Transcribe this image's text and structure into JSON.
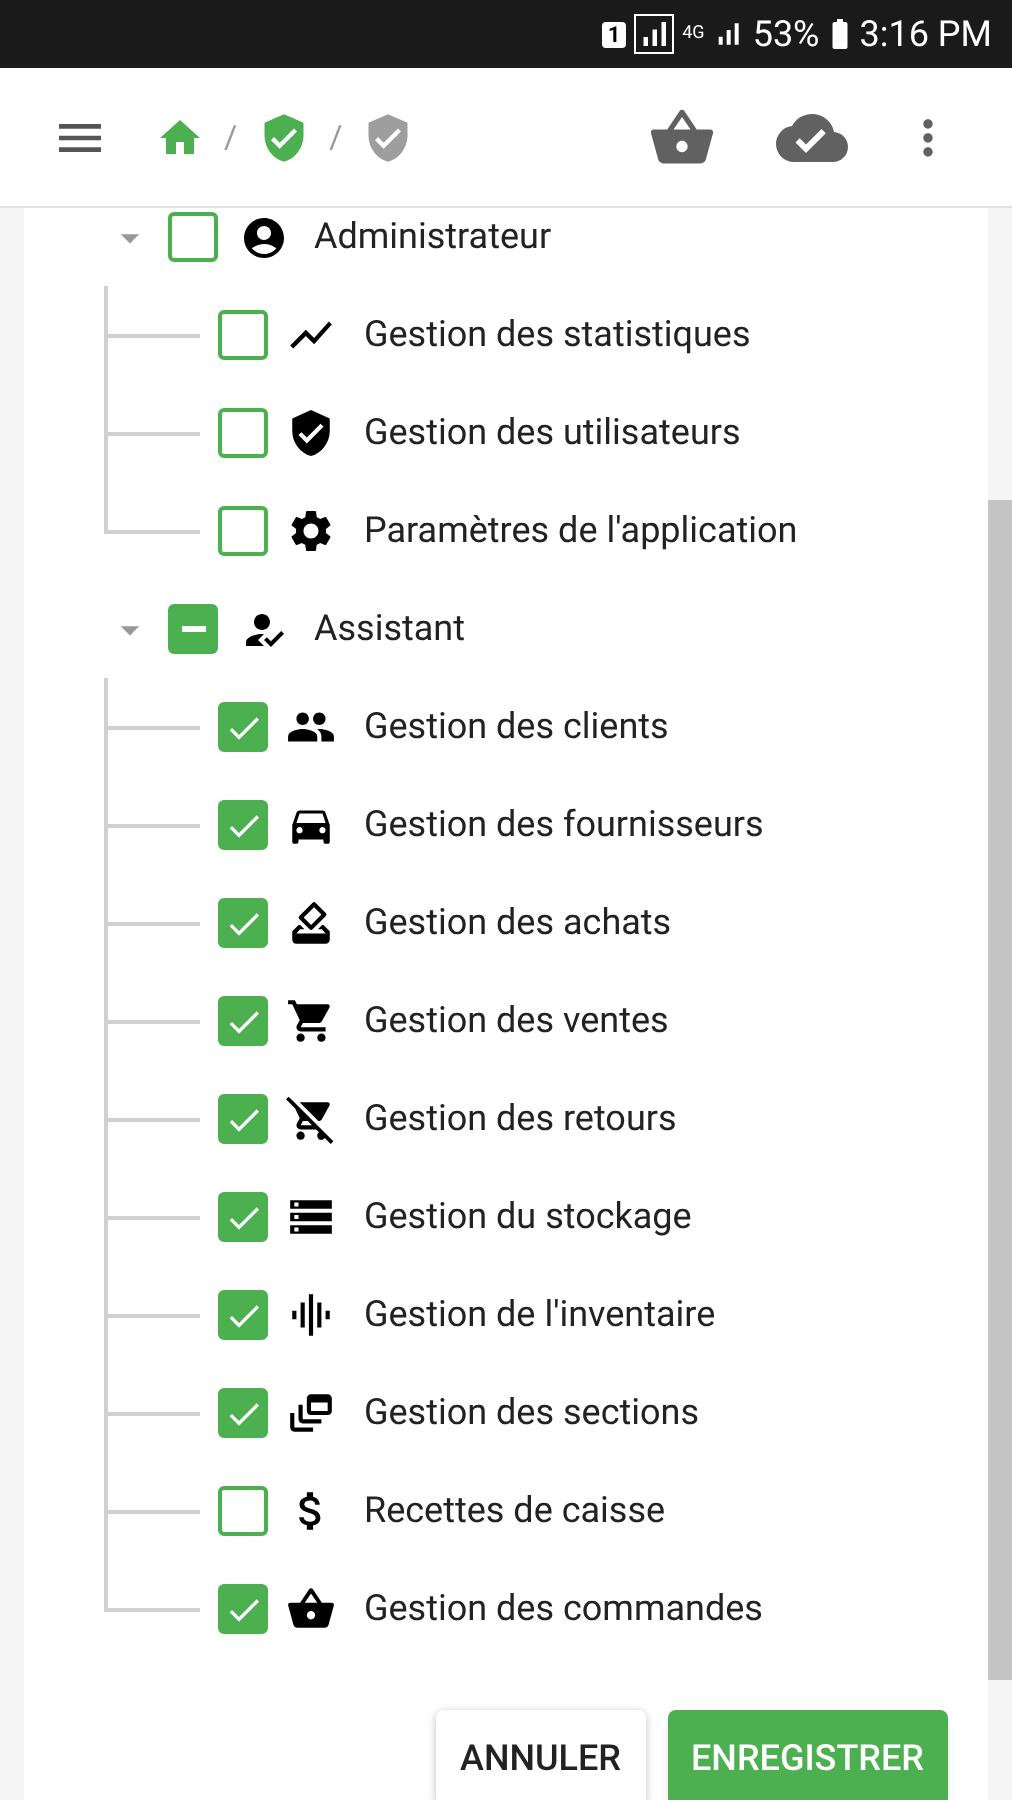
{
  "status_bar": {
    "sim": "1",
    "network": "4G",
    "battery": "53%",
    "time": "3:16 PM"
  },
  "breadcrumb": {
    "separators": [
      "/",
      "/"
    ]
  },
  "tree": [
    {
      "label": "Administrateur",
      "expanded": true,
      "indeterminate": false,
      "children": [
        {
          "label": "Gestion des statistiques",
          "checked": false
        },
        {
          "label": "Gestion des utilisateurs",
          "checked": false
        },
        {
          "label": "Paramètres de l'application",
          "checked": false
        }
      ]
    },
    {
      "label": "Assistant",
      "expanded": true,
      "indeterminate": true,
      "children": [
        {
          "label": "Gestion des clients",
          "checked": true
        },
        {
          "label": "Gestion des fournisseurs",
          "checked": true
        },
        {
          "label": "Gestion des achats",
          "checked": true
        },
        {
          "label": "Gestion des ventes",
          "checked": true
        },
        {
          "label": "Gestion des retours",
          "checked": true
        },
        {
          "label": "Gestion du stockage",
          "checked": true
        },
        {
          "label": "Gestion de l'inventaire",
          "checked": true
        },
        {
          "label": "Gestion des sections",
          "checked": true
        },
        {
          "label": "Recettes de caisse",
          "checked": false
        },
        {
          "label": "Gestion des commandes",
          "checked": true
        }
      ]
    }
  ],
  "buttons": [
    {
      "label": "ANNULER",
      "kind": "text"
    },
    {
      "label": "ENREGISTRER",
      "kind": "primary"
    }
  ]
}
